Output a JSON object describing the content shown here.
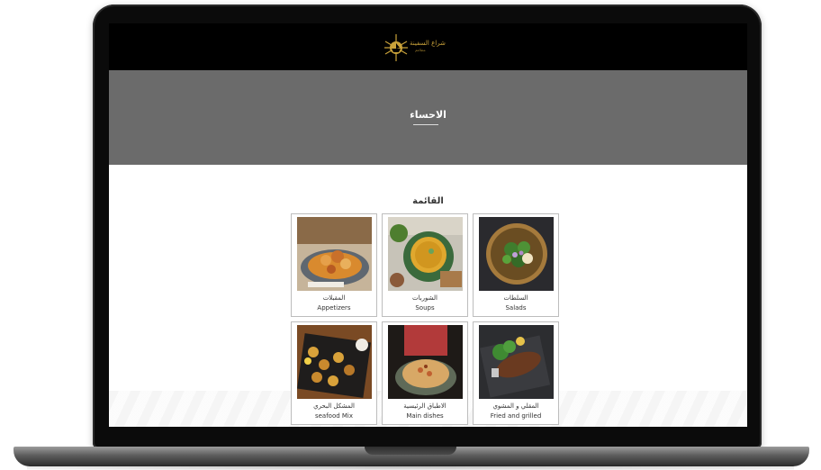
{
  "header": {
    "logo_text": "شراع السفينة",
    "logo_subtext": "مطاعم"
  },
  "hero": {
    "title": "الاحساء"
  },
  "menu": {
    "heading": "القائمة",
    "categories": [
      {
        "ar": "السلطات",
        "en": "Salads",
        "icon": "salad-photo"
      },
      {
        "ar": "الشوربات",
        "en": "Soups",
        "icon": "soup-photo"
      },
      {
        "ar": "المقبلات",
        "en": "Appetizers",
        "icon": "appetizers-photo"
      },
      {
        "ar": "المقلي و المشوي",
        "en": "Fried and grilled",
        "icon": "grilled-fish-photo"
      },
      {
        "ar": "الاطباق الرئيسية",
        "en": "Main dishes",
        "icon": "rice-dish-photo"
      },
      {
        "ar": "المشكل البحري",
        "en": "seafood Mix",
        "icon": "seafood-mix-photo"
      }
    ]
  },
  "colors": {
    "header_bg": "#000000",
    "hero_bg": "#6b6b6b",
    "logo_gold": "#c9a23a",
    "card_border": "#bdbdbd"
  }
}
